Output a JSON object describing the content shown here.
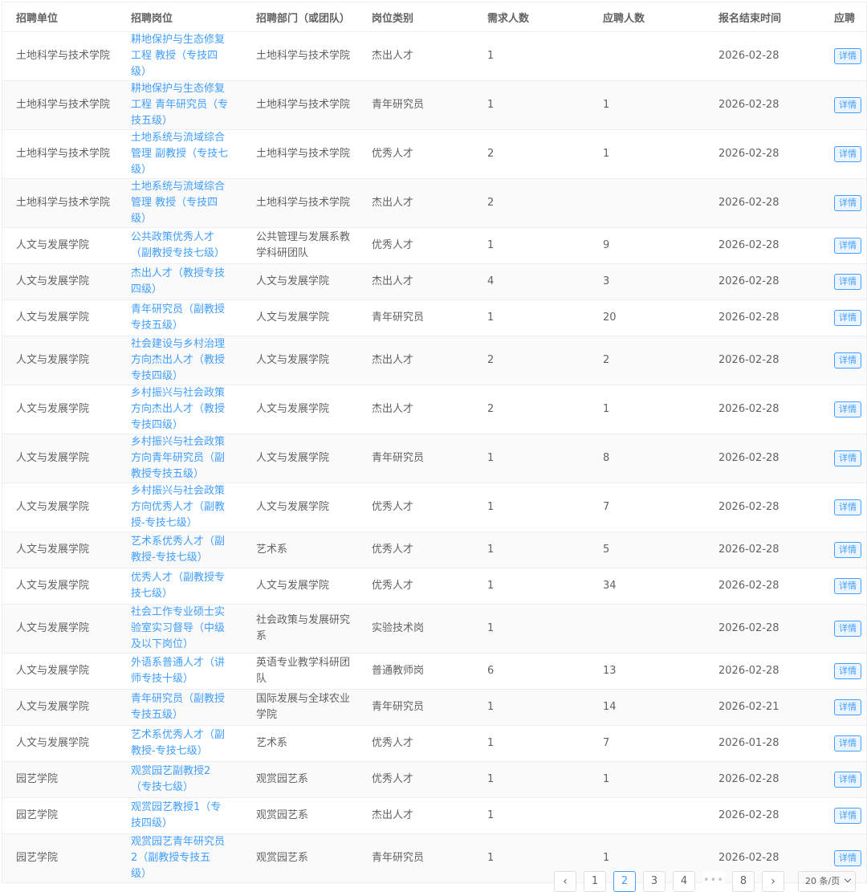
{
  "table": {
    "headers": [
      "招聘单位",
      "招聘岗位",
      "招聘部门（或团队）",
      "岗位类别",
      "需求人数",
      "应聘人数",
      "报名结束时间",
      "应聘"
    ],
    "detail_label": "详情",
    "rows": [
      {
        "unit": "土地科学与技术学院",
        "pos": [
          "耕地保护与生态修复",
          "工程 教授（专技四",
          "级）"
        ],
        "dept": "土地科学与技术学院",
        "cat": "杰出人才",
        "need": "1",
        "apply": "",
        "end": "2026-02-28"
      },
      {
        "unit": "土地科学与技术学院",
        "pos": [
          "耕地保护与生态修复",
          "工程 青年研究员（专",
          "技五级）"
        ],
        "dept": "土地科学与技术学院",
        "cat": "青年研究员",
        "need": "1",
        "apply": "1",
        "end": "2026-02-28"
      },
      {
        "unit": "土地科学与技术学院",
        "pos": [
          "土地系统与流域综合",
          "管理 副教授（专技七",
          "级）"
        ],
        "dept": "土地科学与技术学院",
        "cat": "优秀人才",
        "need": "2",
        "apply": "1",
        "end": "2026-02-28"
      },
      {
        "unit": "土地科学与技术学院",
        "pos": [
          "土地系统与流域综合",
          "管理 教授（专技四",
          "级）"
        ],
        "dept": "土地科学与技术学院",
        "cat": "杰出人才",
        "need": "2",
        "apply": "",
        "end": "2026-02-28"
      },
      {
        "unit": "人文与发展学院",
        "pos": [
          "公共政策优秀人才",
          "（副教授专技七级）"
        ],
        "dept": "公共管理与发展系教学科研团队",
        "cat": "优秀人才",
        "need": "1",
        "apply": "9",
        "end": "2026-02-28"
      },
      {
        "unit": "人文与发展学院",
        "pos": [
          "杰出人才（教授专技",
          "四级）"
        ],
        "dept": "人文与发展学院",
        "cat": "杰出人才",
        "need": "4",
        "apply": "3",
        "end": "2026-02-28"
      },
      {
        "unit": "人文与发展学院",
        "pos": [
          "青年研究员（副教授",
          "专技五级）"
        ],
        "dept": "人文与发展学院",
        "cat": "青年研究员",
        "need": "1",
        "apply": "20",
        "end": "2026-02-28"
      },
      {
        "unit": "人文与发展学院",
        "pos": [
          "社会建设与乡村治理",
          "方向杰出人才（教授",
          "专技四级）"
        ],
        "dept": "人文与发展学院",
        "cat": "杰出人才",
        "need": "2",
        "apply": "2",
        "end": "2026-02-28"
      },
      {
        "unit": "人文与发展学院",
        "pos": [
          "乡村振兴与社会政策",
          "方向杰出人才（教授",
          "专技四级）"
        ],
        "dept": "人文与发展学院",
        "cat": "杰出人才",
        "need": "2",
        "apply": "1",
        "end": "2026-02-28"
      },
      {
        "unit": "人文与发展学院",
        "pos": [
          "乡村振兴与社会政策",
          "方向青年研究员（副",
          "教授专技五级）"
        ],
        "dept": "人文与发展学院",
        "cat": "青年研究员",
        "need": "1",
        "apply": "8",
        "end": "2026-02-28"
      },
      {
        "unit": "人文与发展学院",
        "pos": [
          "乡村振兴与社会政策",
          "方向优秀人才（副教",
          "授-专技七级）"
        ],
        "dept": "人文与发展学院",
        "cat": "优秀人才",
        "need": "1",
        "apply": "7",
        "end": "2026-02-28"
      },
      {
        "unit": "人文与发展学院",
        "pos": [
          "艺术系优秀人才（副",
          "教授-专技七级）"
        ],
        "dept": "艺术系",
        "cat": "优秀人才",
        "need": "1",
        "apply": "5",
        "end": "2026-02-28"
      },
      {
        "unit": "人文与发展学院",
        "pos": [
          "优秀人才（副教授专",
          "技七级）"
        ],
        "dept": "人文与发展学院",
        "cat": "优秀人才",
        "need": "1",
        "apply": "34",
        "end": "2026-02-28"
      },
      {
        "unit": "人文与发展学院",
        "pos": [
          "社会工作专业硕士实",
          "验室实习督导（中级",
          "及以下岗位）"
        ],
        "dept": "社会政策与发展研究系",
        "cat": "实验技术岗",
        "need": "1",
        "apply": "",
        "end": "2026-02-28"
      },
      {
        "unit": "人文与发展学院",
        "pos": [
          "外语系普通人才（讲",
          "师专技十级）"
        ],
        "dept": "英语专业教学科研团队",
        "cat": "普通教师岗",
        "need": "6",
        "apply": "13",
        "end": "2026-02-28"
      },
      {
        "unit": "人文与发展学院",
        "pos": [
          "青年研究员（副教授",
          "专技五级）"
        ],
        "dept": "国际发展与全球农业学院",
        "cat": "青年研究员",
        "need": "1",
        "apply": "14",
        "end": "2026-02-21"
      },
      {
        "unit": "人文与发展学院",
        "pos": [
          "艺术系优秀人才（副",
          "教授-专技七级）"
        ],
        "dept": "艺术系",
        "cat": "优秀人才",
        "need": "1",
        "apply": "7",
        "end": "2026-01-28"
      },
      {
        "unit": "园艺学院",
        "pos": [
          "观赏园艺副教授2",
          "（专技七级）"
        ],
        "dept": "观赏园艺系",
        "cat": "优秀人才",
        "need": "1",
        "apply": "1",
        "end": "2026-02-28"
      },
      {
        "unit": "园艺学院",
        "pos": [
          "观赏园艺教授1（专",
          "技四级）"
        ],
        "dept": "观赏园艺系",
        "cat": "杰出人才",
        "need": "1",
        "apply": "",
        "end": "2026-02-28"
      },
      {
        "unit": "园艺学院",
        "pos": [
          "观赏园艺青年研究员",
          "2（副教授专技五",
          "级）"
        ],
        "dept": "观赏园艺系",
        "cat": "青年研究员",
        "need": "1",
        "apply": "1",
        "end": "2026-02-28"
      }
    ]
  },
  "pagination": {
    "prev_icon": "chevron-left-icon",
    "next_icon": "chevron-right-icon",
    "prev": "‹",
    "next": "›",
    "pages": [
      "1",
      "2",
      "3",
      "4"
    ],
    "more": "•••",
    "last": "8",
    "active": "2",
    "page_size": "20 条/页",
    "page_size_icon": "chevron-down-icon"
  },
  "colors": {
    "link": "#409eff",
    "text": "#606266",
    "border": "#ebeef5"
  }
}
